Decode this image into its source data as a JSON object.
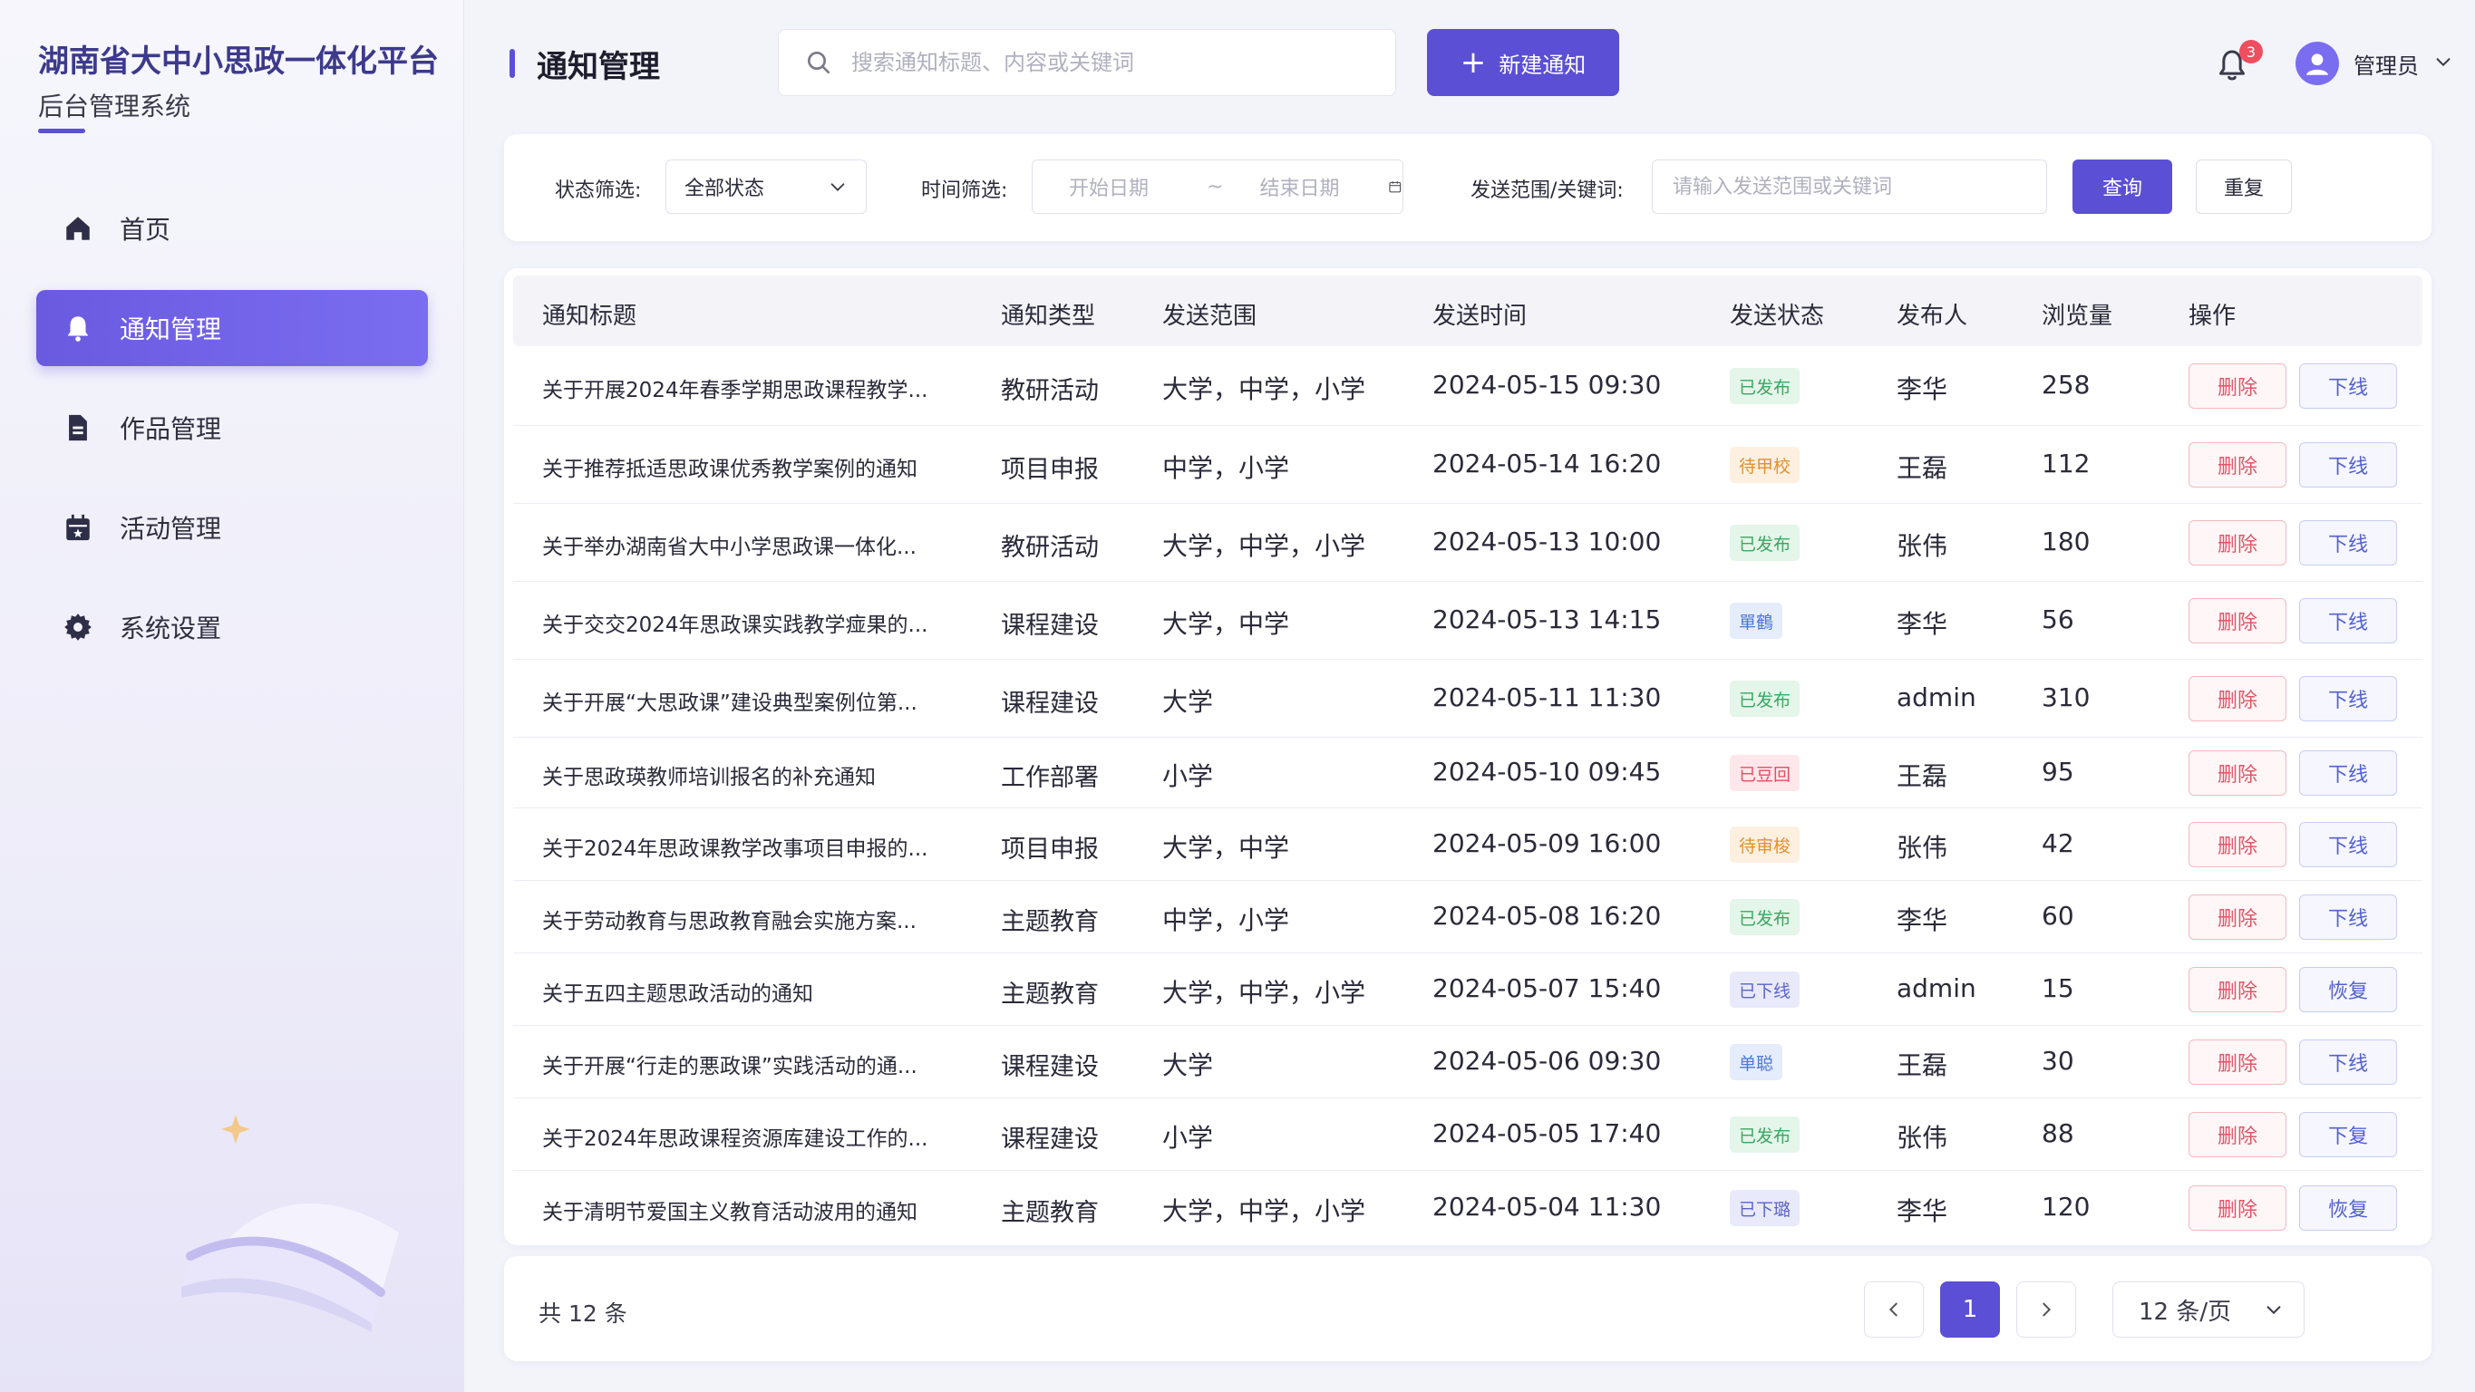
{
  "sidebar": {
    "brand_title": "湖南省大中小思政一体化平台",
    "brand_subtitle": "后台管理系统",
    "items": [
      {
        "label": "首页",
        "icon": "home-icon",
        "active": false
      },
      {
        "label": "通知管理",
        "icon": "bell-icon",
        "active": true
      },
      {
        "label": "作品管理",
        "icon": "document-icon",
        "active": false
      },
      {
        "label": "活动管理",
        "icon": "calendar-icon",
        "active": false
      },
      {
        "label": "系统设置",
        "icon": "gear-icon",
        "active": false
      }
    ]
  },
  "header": {
    "page_title": "通知管理",
    "search_placeholder": "搜索通知标题、内容或关键词",
    "new_button": "新建通知",
    "notification_count": "3",
    "user_name": "管理员"
  },
  "filters": {
    "status_label": "状态筛选:",
    "status_value": "全部状态",
    "time_label": "时间筛选:",
    "start_placeholder": "开始日期",
    "range_sep": "~",
    "end_placeholder": "结束日期",
    "keyword_label": "发送范围/关键词:",
    "keyword_placeholder": "请输入发送范围或关键词",
    "query_button": "查询",
    "reset_button": "重复"
  },
  "table": {
    "columns": [
      "通知标题",
      "通知类型",
      "发送范围",
      "发送时间",
      "发送状态",
      "发布人",
      "浏览量",
      "操作"
    ],
    "rows": [
      {
        "title": "关于开展2024年春季学期思政课程教学...",
        "type": "教研活动",
        "scope": "大学，中学，小学",
        "time": "2024-05-15 09:30",
        "status": "已发布",
        "status_kind": "pub",
        "publisher": "李华",
        "views": "258",
        "del": "删除",
        "act": "下线"
      },
      {
        "title": "关于推荐抵适思政课优秀教学案例的通知",
        "type": "项目申报",
        "scope": "中学，小学",
        "time": "2024-05-14 16:20",
        "status": "待甲校",
        "status_kind": "pend",
        "publisher": "王磊",
        "views": "112",
        "del": "删除",
        "act": "下线"
      },
      {
        "title": "关于举办湖南省大中小学思政课一体化...",
        "type": "教研活动",
        "scope": "大学，中学，小学",
        "time": "2024-05-13 10:00",
        "status": "已发布",
        "status_kind": "pub",
        "publisher": "张伟",
        "views": "180",
        "del": "删除",
        "act": "下线"
      },
      {
        "title": "关于交交2024年思政课实践教学痖果的...",
        "type": "课程建设",
        "scope": "大学，中学",
        "time": "2024-05-13 14:15",
        "status": "單鶴",
        "status_kind": "draft",
        "publisher": "李华",
        "views": "56",
        "del": "删除",
        "act": "下线"
      },
      {
        "title": "关于开展“大思政课”建设典型案例位第...",
        "type": "课程建设",
        "scope": "大学",
        "time": "2024-05-11 11:30",
        "status": "已发布",
        "status_kind": "pub",
        "publisher": "admin",
        "views": "310",
        "del": "删除",
        "act": "下线"
      },
      {
        "title": "关于思政瑛教师培训报名的补充通知",
        "type": "工作部署",
        "scope": "小学",
        "time": "2024-05-10 09:45",
        "status": "已豆回",
        "status_kind": "ret",
        "publisher": "王磊",
        "views": "95",
        "del": "删除",
        "act": "下线"
      },
      {
        "title": "关于2024年思政课教学改事项目申报的...",
        "type": "项目申报",
        "scope": "大学，中学",
        "time": "2024-05-09 16:00",
        "status": "待审梭",
        "status_kind": "pend",
        "publisher": "张伟",
        "views": "42",
        "del": "删除",
        "act": "下线"
      },
      {
        "title": "关于劳动教育与思政教育融会实施方案...",
        "type": "主题教育",
        "scope": "中学，小学",
        "time": "2024-05-08 16:20",
        "status": "已发布",
        "status_kind": "pub",
        "publisher": "李华",
        "views": "60",
        "del": "删除",
        "act": "下线"
      },
      {
        "title": "关于五四主题思政活动的通知",
        "type": "主题教育",
        "scope": "大学，中学，小学",
        "time": "2024-05-07 15:40",
        "status": "已下线",
        "status_kind": "off",
        "publisher": "admin",
        "views": "15",
        "del": "删除",
        "act": "恢复"
      },
      {
        "title": "关于开展“行走的悪政课”实践活动的通...",
        "type": "课程建设",
        "scope": "大学",
        "time": "2024-05-06 09:30",
        "status": "单聪",
        "status_kind": "draft",
        "publisher": "王磊",
        "views": "30",
        "del": "删除",
        "act": "下线"
      },
      {
        "title": "关于2024年思政课程资源库建设工作的...",
        "type": "课程建设",
        "scope": "小学",
        "time": "2024-05-05 17:40",
        "status": "已发布",
        "status_kind": "pub",
        "publisher": "张伟",
        "views": "88",
        "del": "删除",
        "act": "下复"
      },
      {
        "title": "关于清明节爱国主义教育活动波用的通知",
        "type": "主题教育",
        "scope": "大学，中学，小学",
        "time": "2024-05-04 11:30",
        "status": "已下璐",
        "status_kind": "off",
        "publisher": "李华",
        "views": "120",
        "del": "删除",
        "act": "恢复"
      }
    ]
  },
  "pagination": {
    "total": "共 12 条",
    "current": "1",
    "page_size": "12 条/页"
  },
  "colors": {
    "primary": "#5b4fd6",
    "published": "#3aa763",
    "pending": "#e0912b",
    "draft": "#4d78d8",
    "returned": "#e05064",
    "offline": "#5d63c8"
  }
}
